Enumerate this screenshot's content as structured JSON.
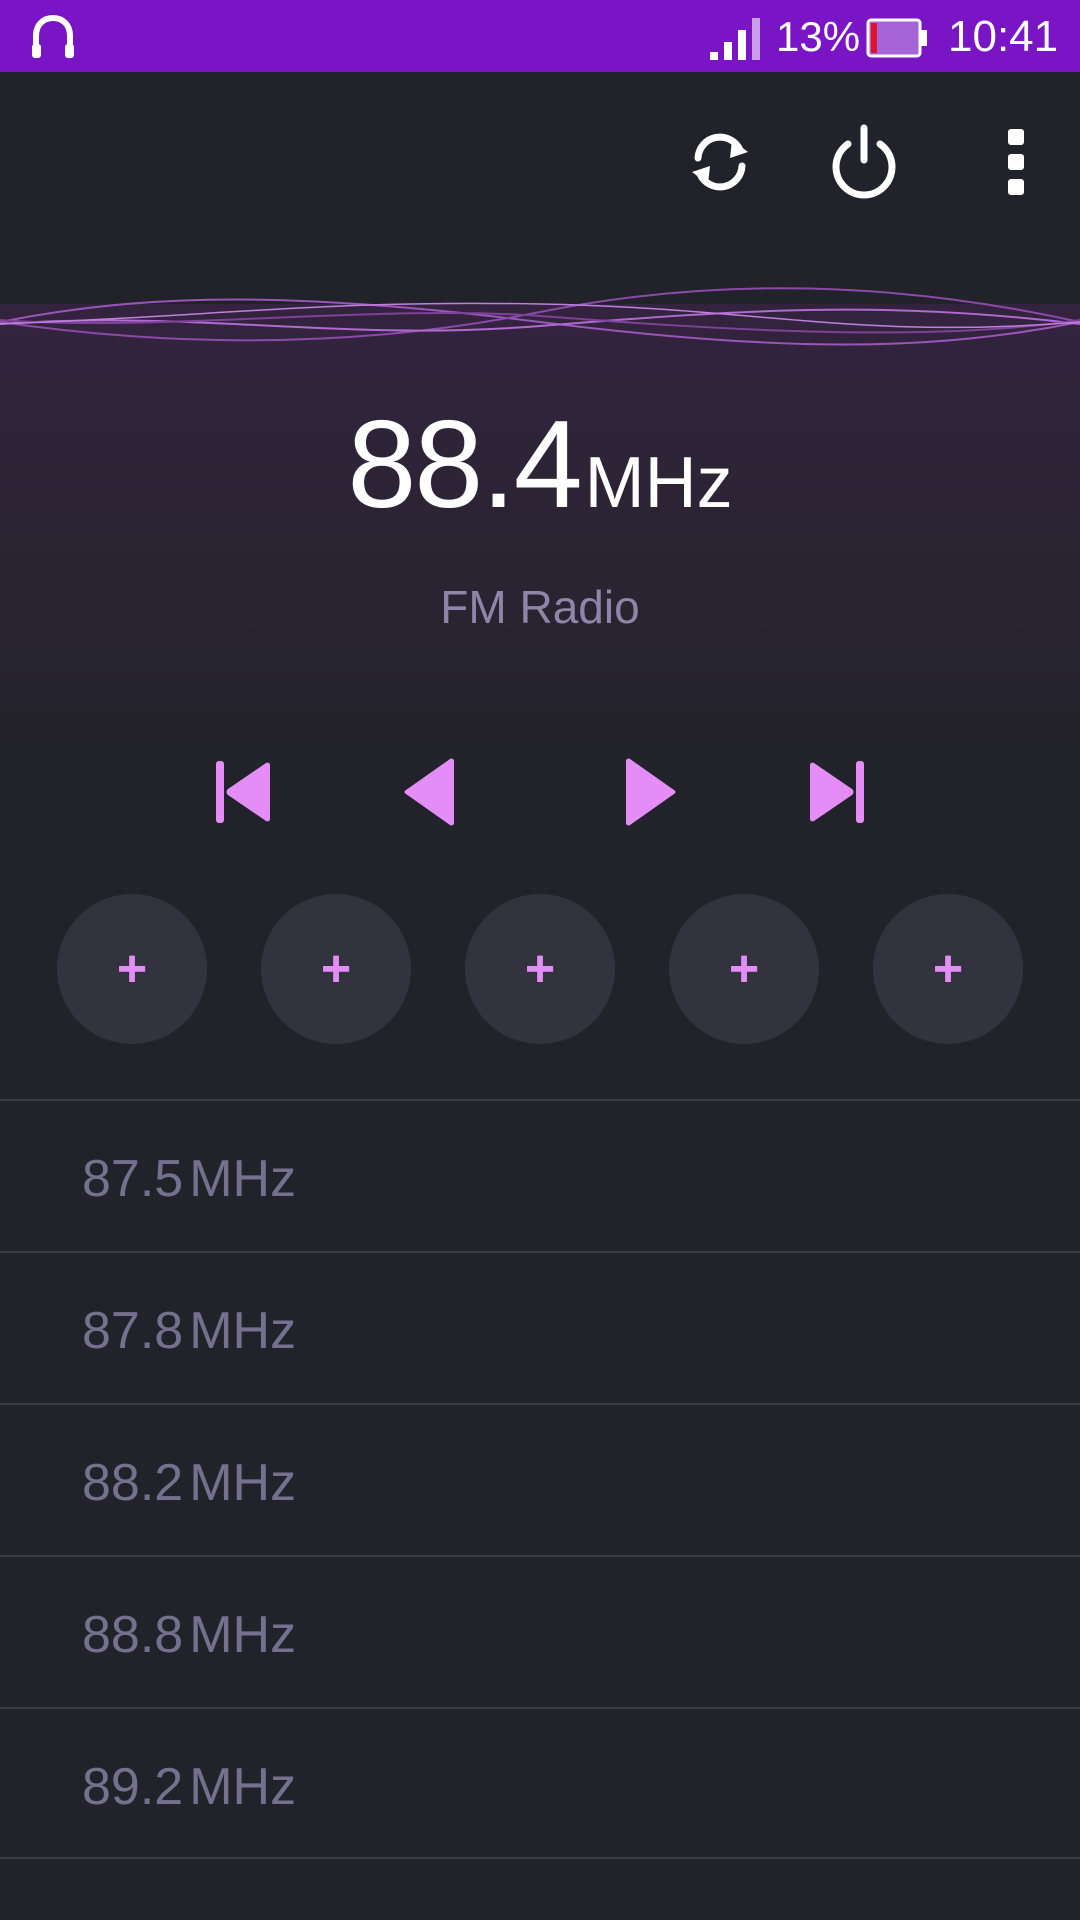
{
  "status_bar": {
    "battery_percent": "13%",
    "time": "10:41",
    "icons": [
      "headphone-icon",
      "signal-icon",
      "battery-icon"
    ],
    "colors": {
      "background": "#7a15c6"
    }
  },
  "toolbar": {
    "icons": [
      "refresh-icon",
      "power-icon",
      "more-vert-icon"
    ]
  },
  "player": {
    "frequency": "88.4",
    "unit": "MHz",
    "station_name": "FM Radio",
    "controls": [
      "skip-previous-icon",
      "seek-back-icon",
      "seek-forward-icon",
      "skip-next-icon"
    ],
    "accent_color": "#e48df6"
  },
  "presets": [
    {
      "label": "+"
    },
    {
      "label": "+"
    },
    {
      "label": "+"
    },
    {
      "label": "+"
    },
    {
      "label": "+"
    }
  ],
  "stations": [
    {
      "freq": "87.5",
      "unit": "MHz"
    },
    {
      "freq": "87.8",
      "unit": "MHz"
    },
    {
      "freq": "88.2",
      "unit": "MHz"
    },
    {
      "freq": "88.8",
      "unit": "MHz"
    },
    {
      "freq": "89.2",
      "unit": "MHz"
    }
  ]
}
